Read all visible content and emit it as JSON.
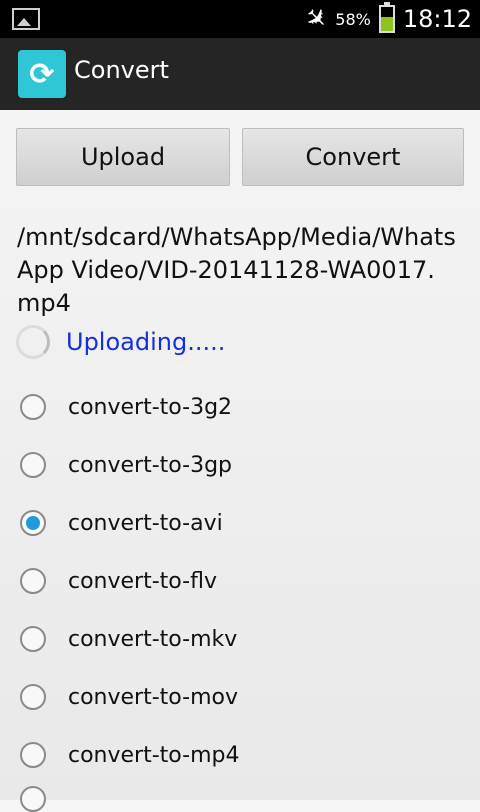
{
  "status_bar": {
    "battery_percent": "58%",
    "battery_level": 0.58,
    "time": "18:12",
    "icons": [
      "image-icon",
      "airplane-mode-icon",
      "battery-icon"
    ]
  },
  "action_bar": {
    "icon": "convert-sync-icon",
    "title": "Convert",
    "brand_color": "#2fc6d6"
  },
  "buttons": {
    "upload": "Upload",
    "convert": "Convert"
  },
  "file_path": "/mnt/sdcard/WhatsApp/Media/WhatsApp Video/VID-20141128-WA0017.mp4",
  "status_text": "Uploading.....",
  "status_color": "#1430d8",
  "options": [
    {
      "label": "convert-to-3g2",
      "checked": false
    },
    {
      "label": "convert-to-3gp",
      "checked": false
    },
    {
      "label": "convert-to-avi",
      "checked": true
    },
    {
      "label": "convert-to-flv",
      "checked": false
    },
    {
      "label": "convert-to-mkv",
      "checked": false
    },
    {
      "label": "convert-to-mov",
      "checked": false
    },
    {
      "label": "convert-to-mp4",
      "checked": false
    }
  ],
  "accent_color": "#1e9bd8"
}
